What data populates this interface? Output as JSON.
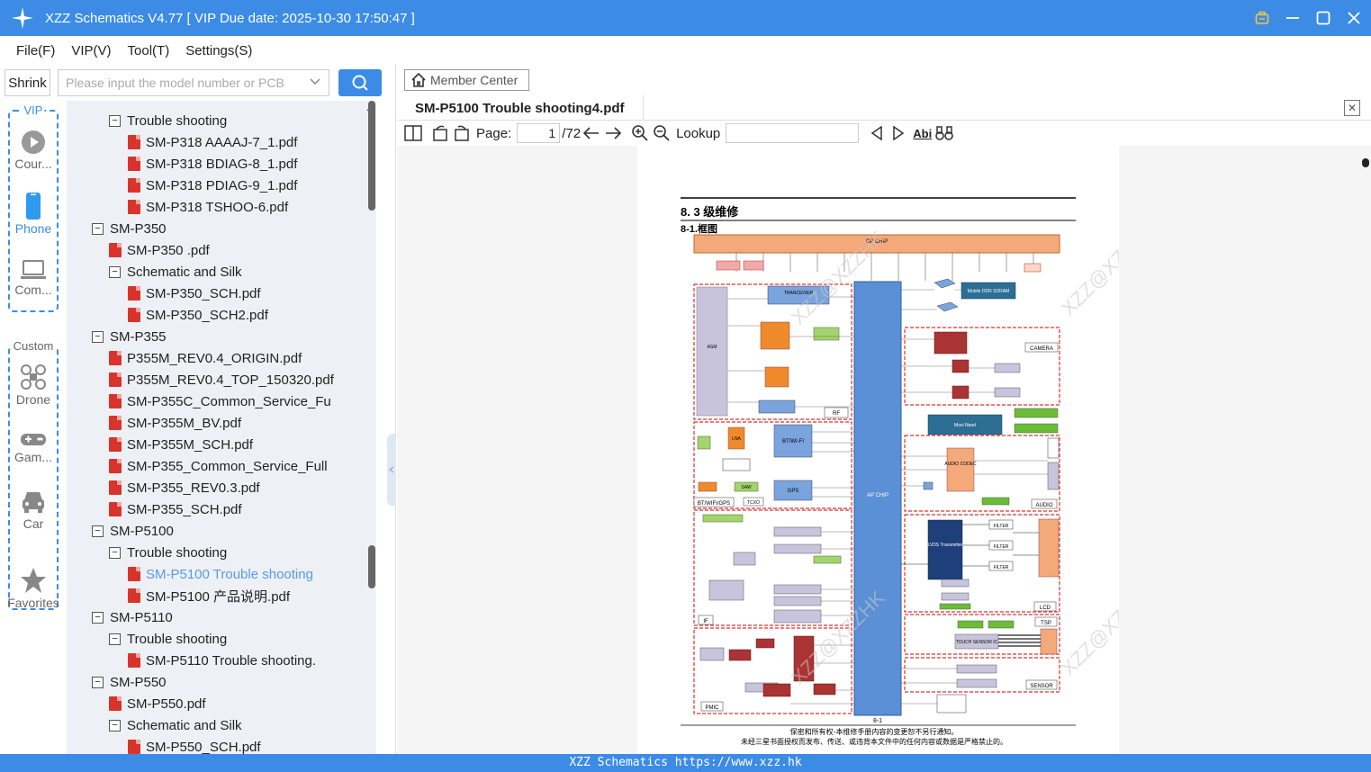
{
  "window": {
    "title": "XZZ Schematics V4.77 [ VIP Due date: 2025-10-30 17:50:47 ]"
  },
  "menu": [
    "File(F)",
    "VIP(V)",
    "Tool(T)",
    "Settings(S)"
  ],
  "sidebar": {
    "shrink_label": "Shrink",
    "search_placeholder": "Please input the model number or PCB",
    "vip_group_label": "VIP",
    "custom_group_label": "Custom",
    "rail": [
      {
        "label": "Cour...",
        "icon": "course-play-icon"
      },
      {
        "label": "Phone",
        "icon": "phone-icon"
      },
      {
        "label": "Com...",
        "icon": "computer-icon"
      },
      {
        "label": "Drone",
        "icon": "drone-icon"
      },
      {
        "label": "Gam...",
        "icon": "gamepad-icon"
      },
      {
        "label": "Car",
        "icon": "car-icon"
      },
      {
        "label": "Favorites",
        "icon": "star-icon"
      }
    ]
  },
  "tree": [
    {
      "label": "Trouble shooting",
      "type": "folder",
      "level": 1
    },
    {
      "label": "SM-P318 AAAAJ-7_1.pdf",
      "type": "file",
      "level": 2
    },
    {
      "label": "SM-P318 BDIAG-8_1.pdf",
      "type": "file",
      "level": 2
    },
    {
      "label": "SM-P318 PDIAG-9_1.pdf",
      "type": "file",
      "level": 2
    },
    {
      "label": "SM-P318 TSHOO-6.pdf",
      "type": "file",
      "level": 2
    },
    {
      "label": "SM-P350",
      "type": "folder",
      "level": 0
    },
    {
      "label": "SM-P350 .pdf",
      "type": "file",
      "level": 1
    },
    {
      "label": "Schematic and Silk",
      "type": "folder",
      "level": 1
    },
    {
      "label": "SM-P350_SCH.pdf",
      "type": "file",
      "level": 2
    },
    {
      "label": "SM-P350_SCH2.pdf",
      "type": "file",
      "level": 2
    },
    {
      "label": "SM-P355",
      "type": "folder",
      "level": 0
    },
    {
      "label": "P355M_REV0.4_ORIGIN.pdf",
      "type": "file",
      "level": 1
    },
    {
      "label": "P355M_REV0.4_TOP_150320.pdf",
      "type": "file",
      "level": 1
    },
    {
      "label": "SM-P355C_Common_Service_Fu",
      "type": "file",
      "level": 1
    },
    {
      "label": "SM-P355M_BV.pdf",
      "type": "file",
      "level": 1
    },
    {
      "label": "SM-P355M_SCH.pdf",
      "type": "file",
      "level": 1
    },
    {
      "label": "SM-P355_Common_Service_Full",
      "type": "file",
      "level": 1
    },
    {
      "label": "SM-P355_REV0.3.pdf",
      "type": "file",
      "level": 1
    },
    {
      "label": "SM-P355_SCH.pdf",
      "type": "file",
      "level": 1
    },
    {
      "label": "SM-P5100",
      "type": "folder",
      "level": 0
    },
    {
      "label": "Trouble shooting",
      "type": "folder",
      "level": 1
    },
    {
      "label": "SM-P5100 Trouble shooting",
      "type": "file",
      "level": 2,
      "selected": true
    },
    {
      "label": "SM-P5100 产品说明.pdf",
      "type": "file",
      "level": 2
    },
    {
      "label": "SM-P5110",
      "type": "folder",
      "level": 0
    },
    {
      "label": "Trouble shooting",
      "type": "folder",
      "level": 1
    },
    {
      "label": "SM-P5110 Trouble shooting.",
      "type": "file",
      "level": 2
    },
    {
      "label": "SM-P550",
      "type": "folder",
      "level": 0
    },
    {
      "label": "SM-P550.pdf",
      "type": "file",
      "level": 1
    },
    {
      "label": "Schematic and Silk",
      "type": "folder",
      "level": 1
    },
    {
      "label": "SM-P550_SCH.pdf",
      "type": "file",
      "level": 2
    }
  ],
  "main": {
    "member_center": "Member Center",
    "tab_title": "SM-P5100 Trouble shooting4.pdf",
    "toolbar": {
      "page_label": "Page:",
      "page_value": "1",
      "page_total": "/72",
      "lookup_label": "Lookup",
      "abi_label": "Abi"
    },
    "doc": {
      "heading": "8. 3 级维修",
      "subheading": "8-1.框图",
      "page_number": "8-1",
      "footer_line1": "保密和所有权-本维修手册内容的变更恕不另行通知。",
      "footer_line2": "未经三星书面授权而发布、传送、或违背本文件中的任何内容或数据是严格禁止的。",
      "watermark": "XZZ@XZZHK",
      "blocks": {
        "cp_chip": "CP CHIP",
        "ap_chip": "AP CHIP",
        "rf": "RF",
        "camera": "CAMERA",
        "audio": "AUDIO",
        "lcd": "LCD",
        "tsp": "TSP",
        "sensor": "SENSOR",
        "pmic": "PMIC",
        "if": "IF",
        "btwifi": "BT/WIFI/GPS",
        "asm": "ASM",
        "tranceiver": "TRANCEIVER",
        "bt_wifi": "BT/WI-FI",
        "gps": "GPS",
        "lvds": "LVDS Transmitter",
        "movi_nand": "Movi Nand",
        "ddr": "Mobile DDR SDRAM",
        "codec": "AUDIO CODEC",
        "touch": "TOUCH SENSOR IC",
        "filter": "FILTER",
        "tcxo": "TCXO",
        "saw": "SAW",
        "lna": "LNA"
      }
    }
  },
  "statusbar": {
    "text": "XZZ Schematics https://www.xzz.hk"
  },
  "colors": {
    "accent": "#3c8ce6",
    "tree_bg": "#edf0f5",
    "selected_text": "#5a9be8",
    "pdf_red": "#d9342b"
  }
}
